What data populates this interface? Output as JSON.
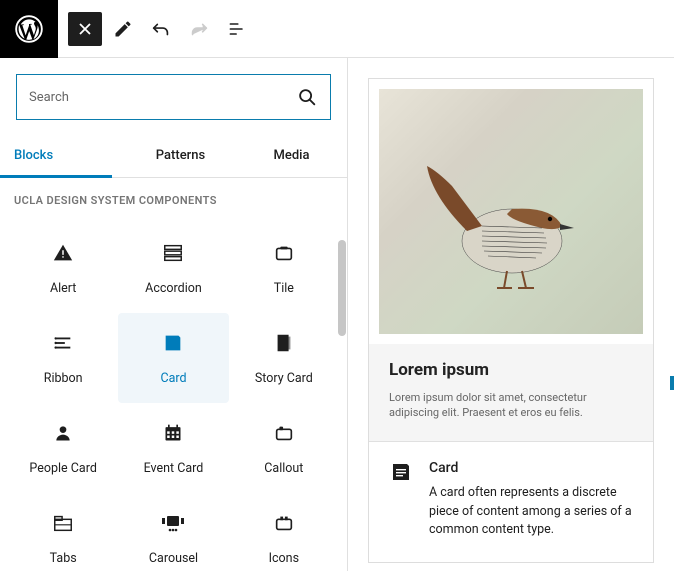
{
  "search": {
    "placeholder": "Search"
  },
  "tabs": {
    "blocks": "Blocks",
    "patterns": "Patterns",
    "media": "Media"
  },
  "section_title": "UCLA DESIGN SYSTEM COMPONENTS",
  "blocks": {
    "alert": "Alert",
    "accordion": "Accordion",
    "tile": "Tile",
    "ribbon": "Ribbon",
    "card": "Card",
    "story_card": "Story Card",
    "people_card": "People Card",
    "event_card": "Event Card",
    "callout": "Callout",
    "tabs": "Tabs",
    "carousel": "Carousel",
    "icons": "Icons"
  },
  "preview": {
    "title": "Lorem ipsum",
    "subtitle": "Lorem ipsum dolor sit amet, consectetur adipiscing elit. Praesent et eros eu felis.",
    "block_name": "Card",
    "block_desc": "A card often represents a discrete piece of content among a series of a common content type."
  }
}
